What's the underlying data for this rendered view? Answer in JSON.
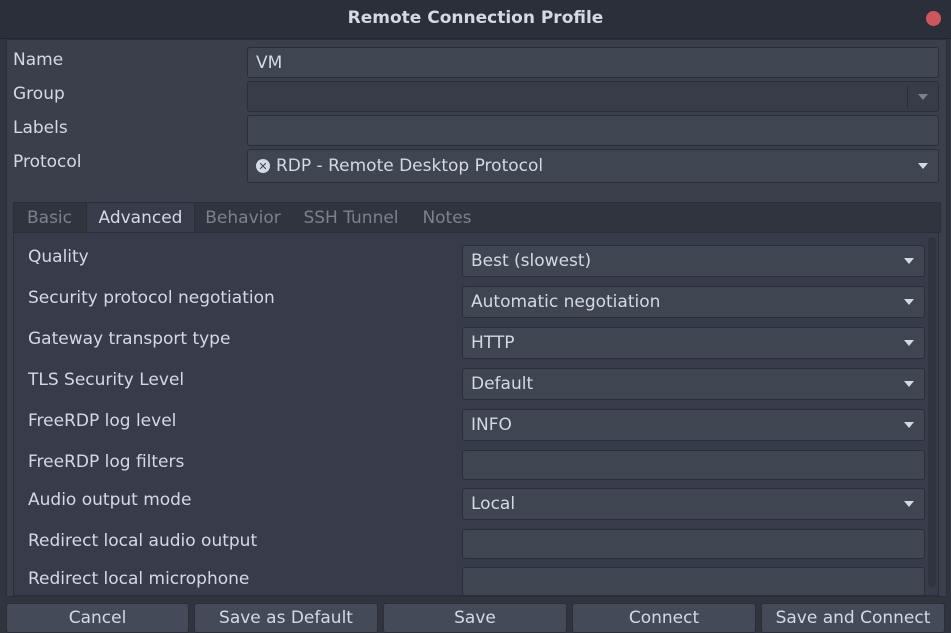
{
  "window": {
    "title": "Remote Connection Profile"
  },
  "profile": {
    "name_label": "Name",
    "name_value": "VM",
    "group_label": "Group",
    "group_value": "",
    "labels_label": "Labels",
    "labels_value": "",
    "protocol_label": "Protocol",
    "protocol_value": "RDP - Remote Desktop Protocol",
    "protocol_icon": "rdp-icon"
  },
  "tabs": [
    {
      "label": "Basic",
      "active": false
    },
    {
      "label": "Advanced",
      "active": true
    },
    {
      "label": "Behavior",
      "active": false
    },
    {
      "label": "SSH Tunnel",
      "active": false
    },
    {
      "label": "Notes",
      "active": false
    }
  ],
  "advanced": {
    "rows": [
      {
        "label": "Quality",
        "value": "Best (slowest)",
        "type": "select"
      },
      {
        "label": "Security protocol negotiation",
        "value": "Automatic negotiation",
        "type": "select"
      },
      {
        "label": "Gateway transport type",
        "value": "HTTP",
        "type": "select"
      },
      {
        "label": "TLS Security Level",
        "value": "Default",
        "type": "select"
      },
      {
        "label": "FreeRDP log level",
        "value": "INFO",
        "type": "select"
      },
      {
        "label": "FreeRDP log filters",
        "value": "",
        "type": "text"
      },
      {
        "label": "Audio output mode",
        "value": "Local",
        "type": "select"
      },
      {
        "label": "Redirect local audio output",
        "value": "",
        "type": "text"
      },
      {
        "label": "Redirect local microphone",
        "value": "",
        "type": "text"
      }
    ]
  },
  "buttons": {
    "cancel": "Cancel",
    "save_default": "Save as Default",
    "save": "Save",
    "connect": "Connect",
    "save_connect": "Save and Connect"
  }
}
